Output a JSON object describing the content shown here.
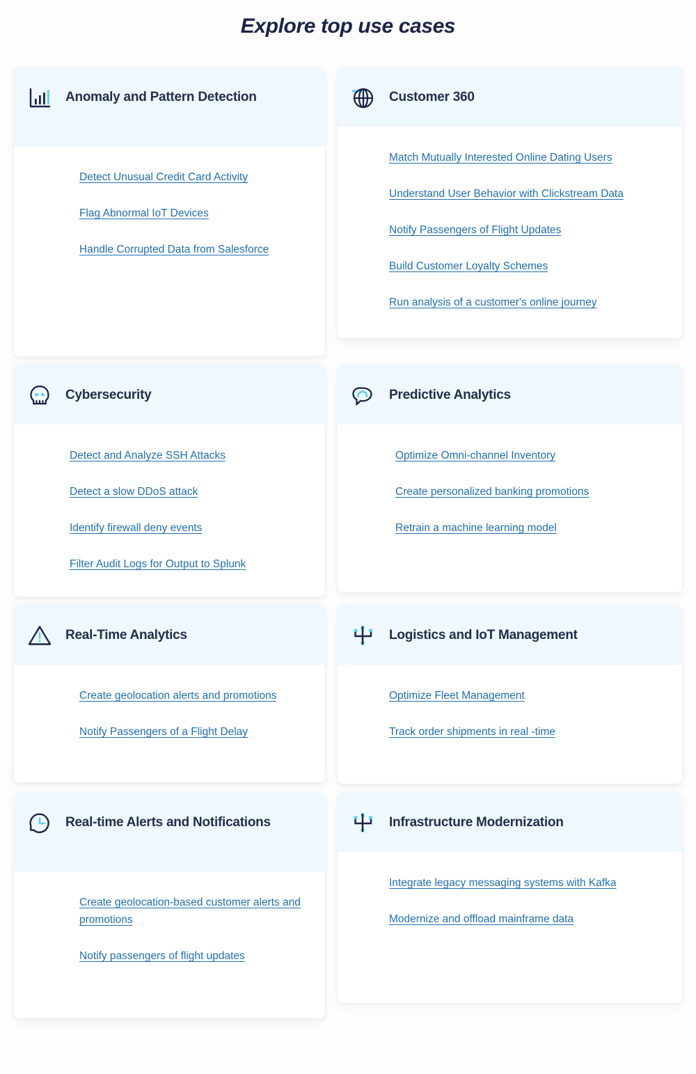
{
  "page": {
    "title": "Explore top use cases",
    "background_color": "#fdfdfd",
    "title_color": "#1b2448",
    "card_header_color": "#eff8fc",
    "card_body_color": "#ffffff",
    "link_color": "#1f6fb3",
    "heading_color": "#21304d",
    "accent_color": "#5ad4f0"
  },
  "cards": [
    {
      "id": "anomaly-and-pattern-detection",
      "title": "Anomaly and Pattern Detection",
      "icon": "bar-chart-icon",
      "links": [
        "Detect Unusual Credit Card Activity",
        "Flag Abnormal IoT Devices ",
        "Handle Corrupted Data from Salesforce"
      ]
    },
    {
      "id": "customer-360",
      "title": "Customer 360",
      "icon": "globe-icon",
      "links": [
        "Match Mutually Interested Online Dating Users",
        "Understand User Behavior with Clickstream Data",
        "Notify Passengers of Flight Updates",
        "Build Customer Loyalty Schemes",
        "Run analysis of a customer's online journey"
      ]
    },
    {
      "id": "cybersecurity",
      "title": "Cybersecurity",
      "icon": "skull-icon",
      "links": [
        "Detect and Analyze SSH Attacks",
        "Detect a slow DDoS attack",
        "Identify firewall deny events ",
        "Filter Audit Logs for Output to Splunk"
      ]
    },
    {
      "id": "predictive-analytics",
      "title": "Predictive Analytics",
      "icon": "brain-icon",
      "links": [
        "Optimize Omni-channel Inventory",
        "Create personalized banking promotions",
        "Retrain a machine learning model"
      ]
    },
    {
      "id": "real-time-analytics",
      "title": "Real-Time Analytics",
      "icon": "warning-triangle-icon",
      "links": [
        "Create geolocation alerts and promotions",
        "Notify Passengers of a Flight Delay"
      ]
    },
    {
      "id": "logistics-and-iot-management",
      "title": "Logistics and IoT Management",
      "icon": "network-topology-icon",
      "links": [
        "Optimize Fleet Management",
        "Track order shipments in real -time"
      ]
    },
    {
      "id": "real-time-alerts-and-notifications",
      "title": "Real-time Alerts and Notifications",
      "icon": "clock-refresh-icon",
      "links": [
        "Create geolocation-based customer alerts and promotions",
        "Notify passengers of flight updates"
      ]
    },
    {
      "id": "infrastructure-modernization",
      "title": "Infrastructure Modernization",
      "icon": "network-topology-icon",
      "links": [
        "Integrate legacy messaging systems with Kafka",
        "Modernize and offload mainframe data"
      ]
    }
  ]
}
